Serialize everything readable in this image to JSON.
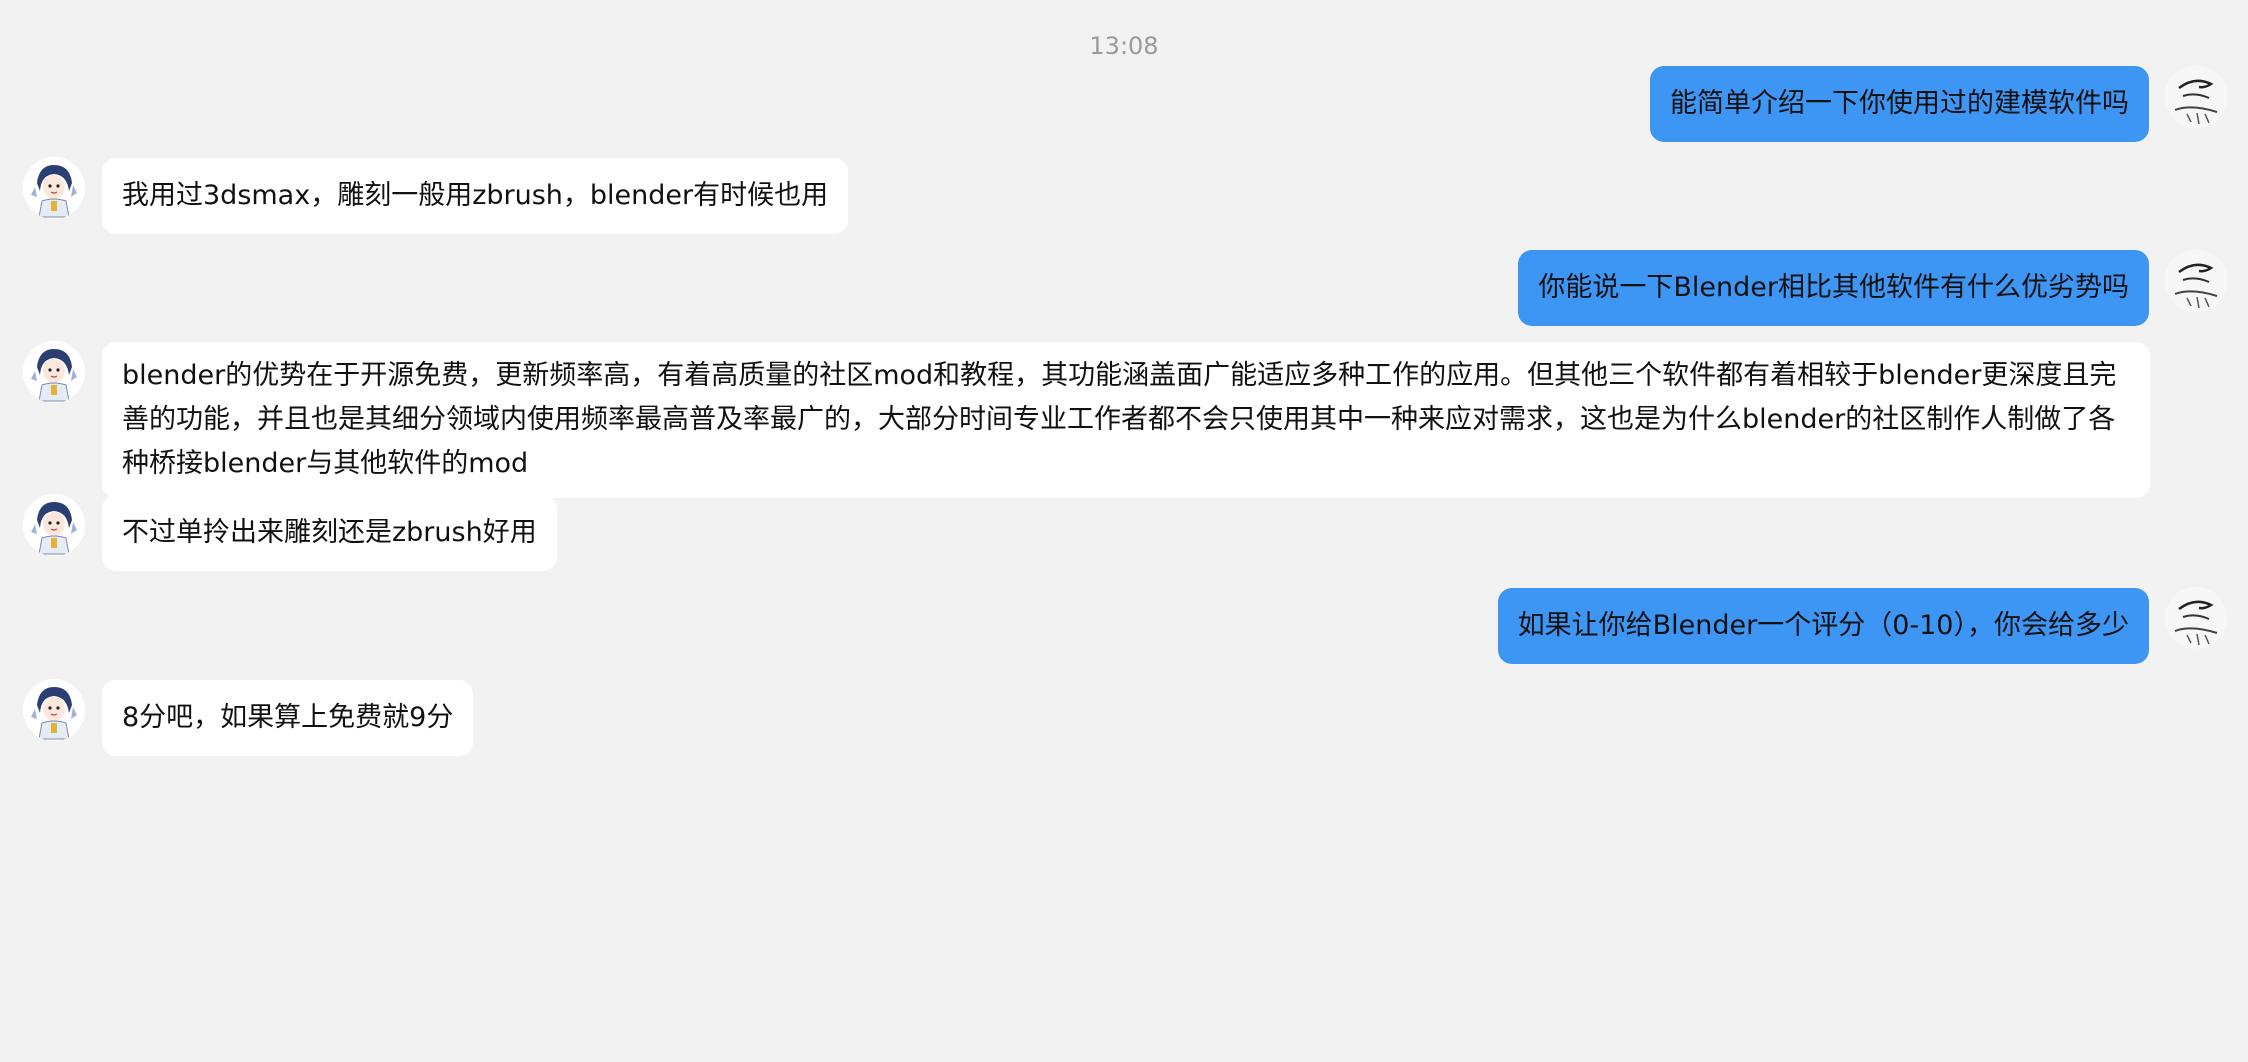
{
  "timestamp": "13:08",
  "colors": {
    "background": "#f2f2f2",
    "incoming_bubble": "#ffffff",
    "outgoing_bubble": "#3d95f4",
    "timestamp_text": "#9a9a9a"
  },
  "messages": [
    {
      "sender": "me",
      "avatar": "user-avatar-icon",
      "text": "能简单介绍一下你使用过的建模软件吗"
    },
    {
      "sender": "other",
      "avatar": "assistant-avatar-icon",
      "text": "我用过3dsmax，雕刻一般用zbrush，blender有时候也用"
    },
    {
      "sender": "me",
      "avatar": "user-avatar-icon",
      "text": "你能说一下Blender相比其他软件有什么优劣势吗"
    },
    {
      "sender": "other",
      "avatar": "assistant-avatar-icon",
      "text": "blender的优势在于开源免费，更新频率高，有着高质量的社区mod和教程，其功能涵盖面广能适应多种工作的应用。但其他三个软件都有着相较于blender更深度且完善的功能，并且也是其细分领域内使用频率最高普及率最广的，大部分时间专业工作者都不会只使用其中一种来应对需求，这也是为什么blender的社区制作人制做了各种桥接blender与其他软件的mod"
    },
    {
      "sender": "other",
      "avatar": "assistant-avatar-icon",
      "text": "不过单拎出来雕刻还是zbrush好用"
    },
    {
      "sender": "me",
      "avatar": "user-avatar-icon",
      "text": "如果让你给Blender一个评分（0-10），你会给多少"
    },
    {
      "sender": "other",
      "avatar": "assistant-avatar-icon",
      "text": "8分吧，如果算上免费就9分"
    }
  ]
}
